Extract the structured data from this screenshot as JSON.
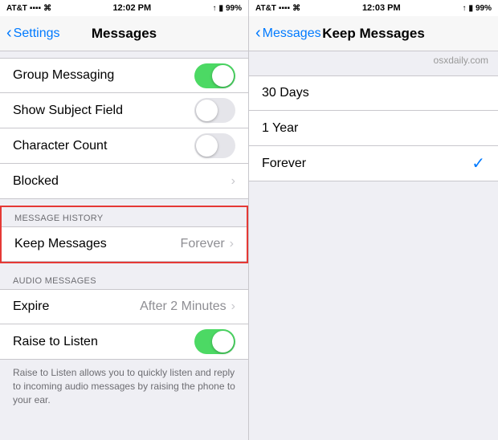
{
  "leftPanel": {
    "statusBar": {
      "carrier": "AT&T",
      "signal": "●●●●",
      "wifi": "WiFi",
      "time": "12:02 PM",
      "battery": "99%"
    },
    "navBar": {
      "backLabel": "Settings",
      "title": "Messages"
    },
    "items": [
      {
        "id": "group-messaging",
        "label": "Group Messaging",
        "type": "toggle",
        "value": true
      },
      {
        "id": "show-subject",
        "label": "Show Subject Field",
        "type": "toggle",
        "value": false
      },
      {
        "id": "character-count",
        "label": "Character Count",
        "type": "toggle",
        "value": false
      },
      {
        "id": "blocked",
        "label": "Blocked",
        "type": "nav",
        "value": ""
      }
    ],
    "messageHistoryHeader": "MESSAGE HISTORY",
    "keepMessages": {
      "label": "Keep Messages",
      "value": "Forever"
    },
    "audioMessagesHeader": "AUDIO MESSAGES",
    "audioItems": [
      {
        "id": "expire",
        "label": "Expire",
        "value": "After 2 Minutes"
      },
      {
        "id": "raise-to-listen",
        "label": "Raise to Listen",
        "type": "toggle",
        "value": true
      }
    ],
    "footerText": "Raise to Listen allows you to quickly listen and reply to incoming audio messages by raising the phone to your ear."
  },
  "rightPanel": {
    "statusBar": {
      "carrier": "AT&T",
      "signal": "●●●●",
      "wifi": "WiFi",
      "time": "12:03 PM",
      "battery": "99%"
    },
    "navBar": {
      "backLabel": "Messages",
      "title": "Keep Messages"
    },
    "watermark": "osxdaily.com",
    "options": [
      {
        "id": "30-days",
        "label": "30 Days",
        "selected": false
      },
      {
        "id": "1-year",
        "label": "1 Year",
        "selected": false
      },
      {
        "id": "forever",
        "label": "Forever",
        "selected": true
      }
    ]
  }
}
